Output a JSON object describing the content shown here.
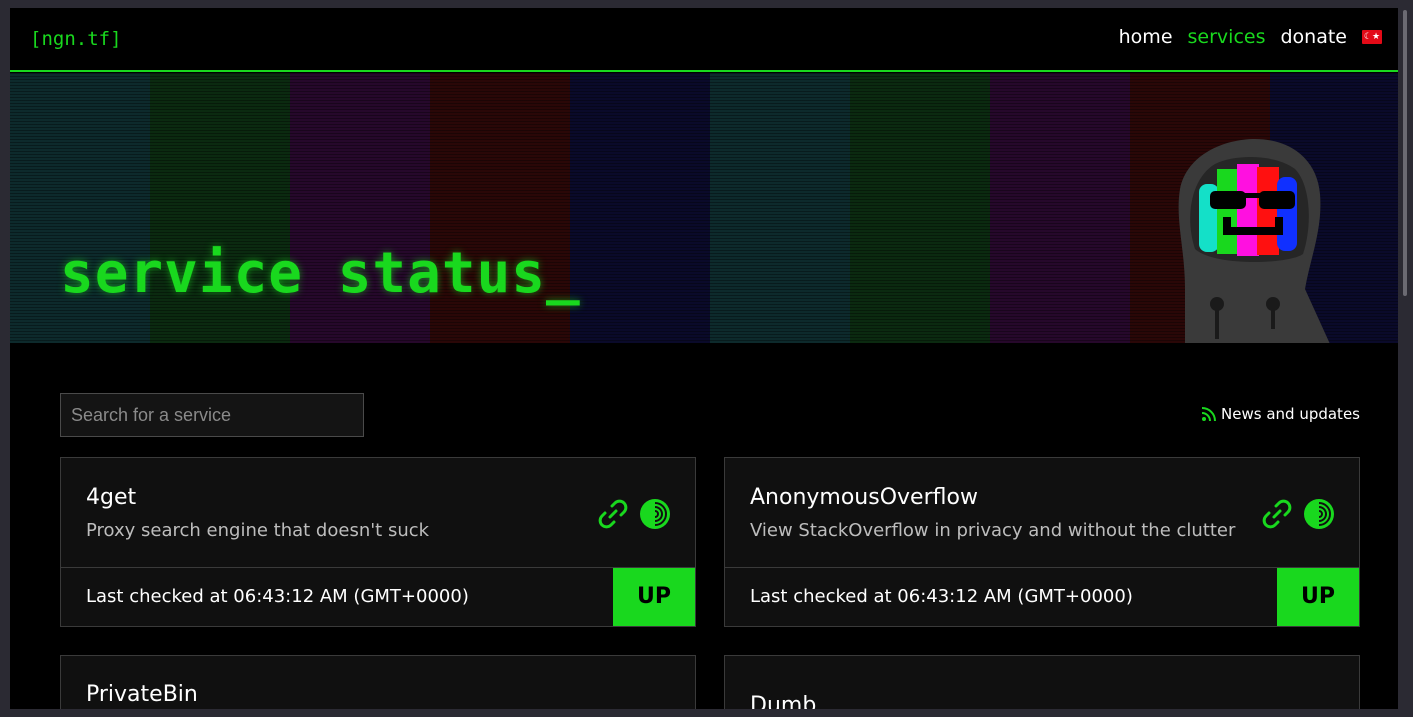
{
  "header": {
    "brand": "[ngn.tf]",
    "nav": [
      {
        "label": "home",
        "active": false
      },
      {
        "label": "services",
        "active": true
      },
      {
        "label": "donate",
        "active": false
      }
    ],
    "flag_icon": "turkey-flag-icon"
  },
  "hero": {
    "title": "service status_"
  },
  "toolbar": {
    "search_placeholder": "Search for a service",
    "search_value": "",
    "news_label": "News and updates",
    "news_icon": "rss-icon"
  },
  "services": [
    {
      "name": "4get",
      "description": "Proxy search engine that doesn't suck",
      "checked": "Last checked at 06:43:12 AM (GMT+0000)",
      "status": "UP"
    },
    {
      "name": "AnonymousOverflow",
      "description": "View StackOverflow in privacy and without the clutter",
      "checked": "Last checked at 06:43:12 AM (GMT+0000)",
      "status": "UP"
    },
    {
      "name": "PrivateBin",
      "description": "",
      "checked": "",
      "status": ""
    },
    {
      "name": "Dumb",
      "description": "",
      "checked": "",
      "status": ""
    }
  ],
  "colors": {
    "accent": "#19d81e",
    "background": "#000000",
    "card": "#101010"
  }
}
